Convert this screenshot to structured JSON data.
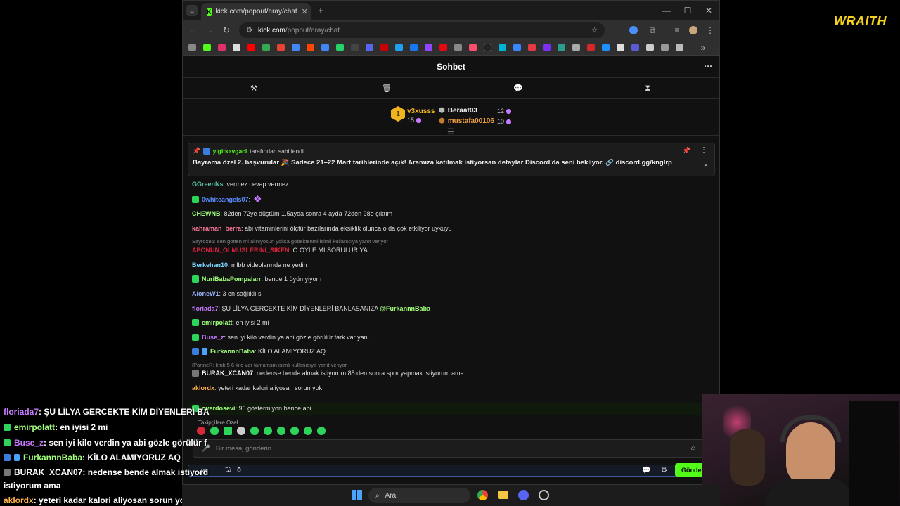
{
  "overlay_brand": "WRAITH",
  "browser": {
    "tab_title": "kick.com/popout/eray/chat",
    "url_domain": "kick.com",
    "url_path": "/popout/eray/chat",
    "new_tab": "+",
    "menu": "⋮"
  },
  "chat": {
    "header": "Sohbet",
    "leaderboard": [
      {
        "rank": "1",
        "name": "v3xusss",
        "count": "15"
      },
      {
        "name": "Beraat03",
        "count": "12"
      },
      {
        "name": "mustafa00106",
        "count": "10"
      }
    ],
    "pinned": {
      "by_user": "yigitkavgaci",
      "by_text": "tarafından sabitlendi",
      "message": "Bayrama özel 2. başvurular 🎉 Sadece 21–22 Mart tarihlerinde açık! Aramıza katılmak istiyorsan detaylar Discord'da seni bekliyor. 🔗 discord.gg/knglrp"
    },
    "messages": [
      {
        "user": "GGreenNs",
        "text": ": vermez cevap vermez",
        "color": "#58c4a8"
      },
      {
        "user": "0whiteangels07",
        "text": ": ",
        "color": "#5b8cff"
      },
      {
        "user": "CHEWNB",
        "text": ": 82den 72ye düştüm 1.5ayda sonra 4 ayda 72den 98e çıktım",
        "color": "#a0ff7a"
      },
      {
        "user": "kahraman_berra",
        "text": ": abi vitaminlerini ölçtür bazılarında eksiklik olunca o da çok etkiliyor uykuyu",
        "color": "#ff7a9a"
      },
      {
        "user": "APONUN_OLMUSLERINI_SIKEN",
        "text": ": O ÖYLE Mİ SORULUR YA",
        "color": "#e0243c"
      },
      {
        "user": "Berkehan10",
        "text": ": mlbb videolarında ne yedin",
        "color": "#7ad6ff"
      },
      {
        "user": "NuriBabaPompalarr",
        "text": ": bende 1 öyün yiyom",
        "color": "#a0ff7a"
      },
      {
        "user": "AloneW1",
        "text": ": 3 en sağlıklı si",
        "color": "#9ab6ff"
      },
      {
        "user": "floriada7",
        "text": ": ŞU LİLYA GERCEKTE KİM DİYENLERİ BANLASANIZA",
        "color": "#c77aff"
      },
      {
        "user": "emirpolatt",
        "text": ": en iyisi 2 mi",
        "color": "#a0ff7a"
      },
      {
        "user": "Buse_z",
        "text": ": sen iyi kilo verdin ya abi gözle görülür fark var yani",
        "color": "#c77aff"
      },
      {
        "user": "FurkannnBaba",
        "text": ": KİLO ALAMIYORUZ AQ",
        "color": "#a0ff7a"
      },
      {
        "user": "BURAK_XCAN07",
        "text": ": nedense bende almak istiyorum 85 den sonra spor yapmak istiyorum ama",
        "color": "#ffffff"
      },
      {
        "user": "aklordx",
        "text": ": yeteri kadar kalori aliyosan sorun yok",
        "color": "#ffb347"
      },
      {
        "user": "overdosevi",
        "text": ": 96 göstermiyon bence abi",
        "color": "#a0ff7a"
      }
    ],
    "mention": "@FurkannnBaba",
    "reply1": "Sayrox96: sen götten mi alınıyosun yoksa göbektenmi isimli kullanıcıya yanıt veriyor",
    "reply2": "IPartneR: kmk 5 6 kilo ver tamamsın isimli kullanıcıya yanıt veriyor",
    "emote_label": "Takipçilere Özel",
    "input_placeholder": "Bir mesaj gönderin",
    "points": "0",
    "send": "Gönder"
  },
  "overlay_chat": [
    {
      "user": "floriada7",
      "text": ": ŞU LİLYA GERCEKTE KİM DİYENLERİ BA",
      "color": "#c77aff"
    },
    {
      "user": "emirpolatt",
      "text": ": en iyisi 2 mi",
      "color": "#a0ff7a"
    },
    {
      "user": "Buse_z",
      "text": ": sen iyi kilo verdin ya abi gözle görülür f",
      "color": "#c77aff"
    },
    {
      "user": "FurkannnBaba",
      "text": ": KİLO ALAMIYORUZ AQ",
      "color": "#a0ff7a"
    },
    {
      "user": "BURAK_XCAN07",
      "text": ": nedense bende almak istiyord",
      "color": "#ffffff"
    },
    {
      "user": "",
      "text": "istiyorum ama",
      "color": "#ffffff"
    },
    {
      "user": "aklordx",
      "text": ": yeteri kadar kalori aliyosan sorun yok",
      "color": "#ffb347"
    }
  ],
  "taskbar": {
    "search": "Ara"
  }
}
